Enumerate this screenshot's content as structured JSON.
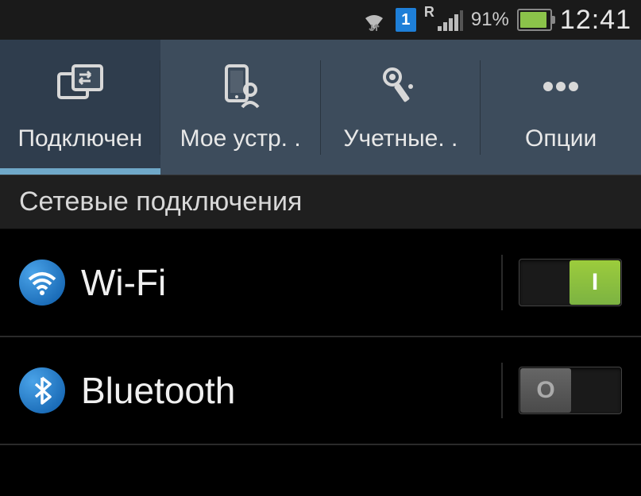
{
  "status": {
    "sim": "1",
    "roaming": "R",
    "battery_pct": "91%",
    "battery_level": 91,
    "time": "12:41"
  },
  "tabs": [
    {
      "id": "connections",
      "label": "Подключен",
      "active": true
    },
    {
      "id": "device",
      "label": "Мое устр. .",
      "active": false
    },
    {
      "id": "accounts",
      "label": "Учетные. .",
      "active": false
    },
    {
      "id": "options",
      "label": "Опции",
      "active": false
    }
  ],
  "section": {
    "title": "Сетевые подключения"
  },
  "settings": [
    {
      "id": "wifi",
      "label": "Wi-Fi",
      "on": true
    },
    {
      "id": "bluetooth",
      "label": "Bluetooth",
      "on": false
    }
  ],
  "toggle": {
    "on_glyph": "I",
    "off_glyph": "O"
  }
}
